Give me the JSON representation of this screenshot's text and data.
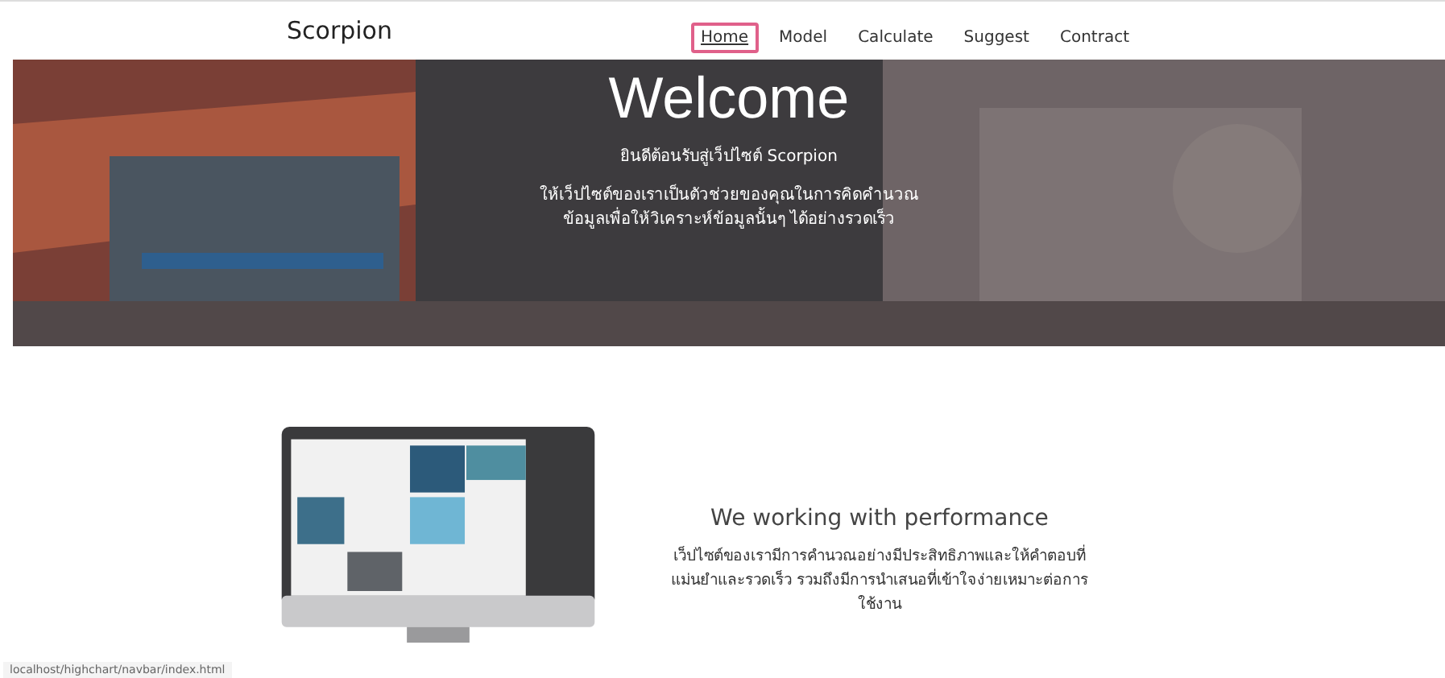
{
  "navbar": {
    "brand": "Scorpion",
    "links": [
      {
        "label": "Home",
        "selected": true,
        "highlighted": true
      },
      {
        "label": "Model",
        "selected": false,
        "highlighted": false
      },
      {
        "label": "Calculate",
        "selected": false,
        "highlighted": false
      },
      {
        "label": "Suggest",
        "selected": false,
        "highlighted": false
      },
      {
        "label": "Contract",
        "selected": false,
        "highlighted": false
      }
    ]
  },
  "hero": {
    "kind": "picture",
    "title": "Welcome",
    "subtitle": "ยินดีต้อนรับสู่เว็ปไซต์ Scorpion",
    "lines": [
      "ให้เว็ปไซต์ของเราเป็นตัวช่วยของคุณในการคิดคำนวณ",
      "ข้อมูลเพื่อให้วิเคราะห์ข้อมูลนั้นๆ ได้อย่างรวดเร็ว"
    ]
  },
  "feature": {
    "kind": "picture",
    "heading": "We working with performance",
    "text": "เว็ปไซต์ของเรามีการคำนวณอย่างมีประสิทธิภาพและให้คำตอบที่แม่นยำและรวดเร็ว รวมถึงมีการนำเสนอที่เข้าใจง่ายเหมาะต่อการใช้งาน"
  },
  "status_bar": {
    "url": "localhost/highchart/navbar/index.html"
  }
}
